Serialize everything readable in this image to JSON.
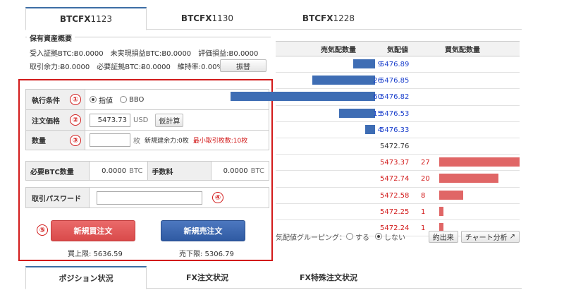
{
  "top_tabs": [
    {
      "prefix": "BTCFX",
      "num": "1123",
      "active": true
    },
    {
      "prefix": "BTCFX",
      "num": "1130",
      "active": false
    },
    {
      "prefix": "BTCFX",
      "num": "1228",
      "active": false
    }
  ],
  "assets": {
    "title": "保有資産概要",
    "row1": "受入証拠BTC:Ƀ0.0000　未実現損益BTC:Ƀ0.0000　評価損益:Ƀ0.0000",
    "row2": "取引余力:Ƀ0.0000　必要証拠BTC:Ƀ0.0000　維持率:0.00%",
    "switch_label": "振替"
  },
  "order": {
    "condition": {
      "label": "執行条件",
      "marker": "①",
      "opt1": "指値",
      "opt2": "BBO"
    },
    "price": {
      "label": "注文価格",
      "marker": "②",
      "value": "5473.73",
      "unit": "USD",
      "calc_label": "仮計算"
    },
    "qty": {
      "label": "数量",
      "marker": "③",
      "unit": "枚",
      "capacity": "新規建余力:0枚",
      "min": "最小取引枚数:10枚"
    },
    "btc_required": {
      "label": "必要BTC数量",
      "value": "0.0000",
      "unit": "BTC"
    },
    "fee": {
      "label": "手数料",
      "value": "0.0000",
      "unit": "BTC"
    },
    "password": {
      "label": "取引パスワード",
      "marker": "④"
    },
    "buy_marker": "⑤",
    "buy_label": "新規買注文",
    "sell_label": "新規売注文",
    "buy_limit": "買上限: 5636.59",
    "sell_limit": "売下限: 5306.79"
  },
  "book": {
    "headers": [
      "売気配数量",
      "気配値",
      "買気配数量"
    ],
    "sell_rows": [
      {
        "qty": "9",
        "price": "5476.89"
      },
      {
        "qty": "26",
        "price": "5476.85"
      },
      {
        "qty": "60",
        "price": "5476.82"
      },
      {
        "qty": "15",
        "price": "5476.53"
      },
      {
        "qty": "4",
        "price": "5476.33"
      }
    ],
    "mid_price": "5472.76",
    "buy_rows": [
      {
        "qty": "27",
        "price": "5473.37"
      },
      {
        "qty": "20",
        "price": "5472.74"
      },
      {
        "qty": "8",
        "price": "5472.58"
      },
      {
        "qty": "1",
        "price": "5472.25"
      },
      {
        "qty": "1",
        "price": "5472.24"
      }
    ],
    "grouping_label": "気配値グルーピング：",
    "grouping_on": "する",
    "grouping_off": "しない",
    "executed_label": "約出来",
    "chart_label": "チャート分析"
  },
  "bottom_tabs": [
    "ポジション状況",
    "FX注文状況",
    "FX特殊注文状況"
  ],
  "colors": {
    "accent": "#3d6ea5",
    "buy": "#d94a4a",
    "sell": "#2f5aa2",
    "highlight": "#d21a1a"
  }
}
